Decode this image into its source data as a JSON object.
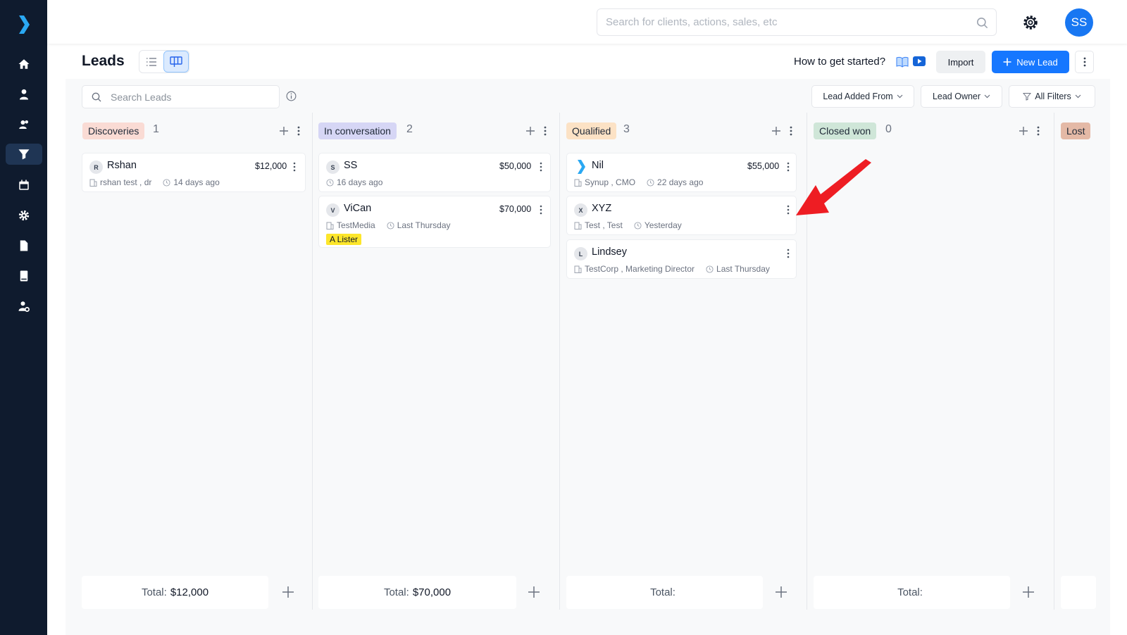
{
  "topbar": {
    "search_placeholder": "Search for clients, actions, sales, etc",
    "avatar_initials": "SS"
  },
  "sidebar": {
    "items": [
      {
        "icon": "home-icon"
      },
      {
        "icon": "user-icon"
      },
      {
        "icon": "users-icon"
      },
      {
        "icon": "funnel-icon",
        "active": true
      },
      {
        "icon": "calendar-icon"
      },
      {
        "icon": "gear-icon"
      },
      {
        "icon": "document-icon"
      },
      {
        "icon": "book-icon"
      },
      {
        "icon": "user-settings-icon"
      }
    ]
  },
  "header": {
    "title": "Leads",
    "help_text": "How to get started?",
    "import_label": "Import",
    "new_lead_label": "New Lead"
  },
  "toolbar": {
    "search_placeholder": "Search Leads",
    "filters": [
      "Lead Added From",
      "Lead Owner",
      "All Filters"
    ]
  },
  "columns": [
    {
      "name": "Discoveries",
      "count": "1",
      "color": "#fadbd4",
      "total_label": "Total:",
      "total_value": "$12,000",
      "cards": [
        {
          "initial": "R",
          "name": "Rshan",
          "amount": "$12,000",
          "company": "rshan test , dr",
          "time": "14 days ago"
        }
      ]
    },
    {
      "name": "In conversation",
      "count": "2",
      "color": "#d6d6f5",
      "total_label": "Total:",
      "total_value": "$70,000",
      "cards": [
        {
          "initial": "S",
          "name": "SS",
          "amount": "$50,000",
          "company": "",
          "time": "16 days ago"
        },
        {
          "initial": "V",
          "name": "ViCan",
          "amount": "$70,000",
          "company": "TestMedia",
          "time": "Last Thursday",
          "tag": "A Lister"
        }
      ]
    },
    {
      "name": "Qualified",
      "count": "3",
      "color": "#fce2c5",
      "total_label": "Total:",
      "total_value": "",
      "cards": [
        {
          "initial": "logo",
          "name": "Nil",
          "amount": "$55,000",
          "company": "Synup , CMO",
          "time": "22 days ago"
        },
        {
          "initial": "X",
          "name": "XYZ",
          "amount": "",
          "company": "Test , Test",
          "time": "Yesterday"
        },
        {
          "initial": "L",
          "name": "Lindsey",
          "amount": "",
          "company": "TestCorp , Marketing Director",
          "time": "Last Thursday"
        }
      ]
    },
    {
      "name": "Closed won",
      "count": "0",
      "color": "#cfe6d8",
      "total_label": "Total:",
      "total_value": "",
      "cards": []
    },
    {
      "name": "Lost",
      "count": "",
      "color": "#e4b9a6",
      "total_label": "",
      "total_value": "",
      "cards": []
    }
  ],
  "annotation": {
    "arrow_color": "#ee1d23"
  }
}
